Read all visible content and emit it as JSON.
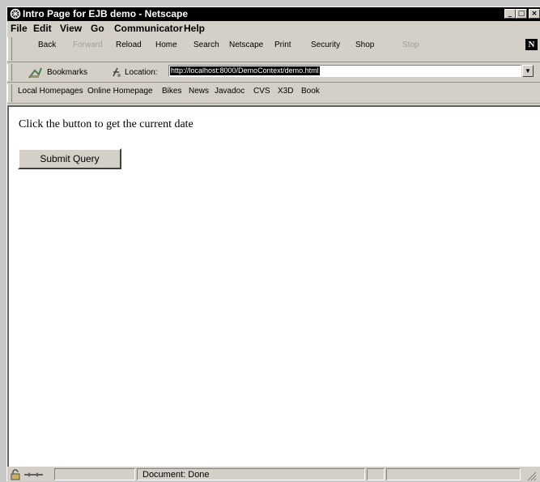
{
  "window": {
    "title": "Intro Page for EJB demo - Netscape"
  },
  "window_buttons": {
    "minimize": "_",
    "maximize": "□",
    "close": "×"
  },
  "menu": [
    "File",
    "Edit",
    "View",
    "Go",
    "Communicator",
    "Help"
  ],
  "nav_toolbar": {
    "buttons": [
      "Back",
      "Forward",
      "Reload",
      "Home",
      "Search",
      "Netscape",
      "Print",
      "Security",
      "Shop",
      "Stop"
    ],
    "disabled": [
      "Forward",
      "Stop"
    ],
    "logo": "N"
  },
  "location_bar": {
    "bookmarks_label": "Bookmarks",
    "location_label": "Location:",
    "url": "http://localhost:8000/DemoContext/demo.html",
    "dropdown": "▼"
  },
  "personal_toolbar": {
    "links": [
      "Local Homepages",
      "Online Homepage",
      "Bikes",
      "News",
      "Javadoc",
      "CVS",
      "X3D",
      "Book"
    ]
  },
  "page": {
    "text": "Click the button to get the current date",
    "submit_label": "Submit Query"
  },
  "status_bar": {
    "text": "Document: Done"
  }
}
